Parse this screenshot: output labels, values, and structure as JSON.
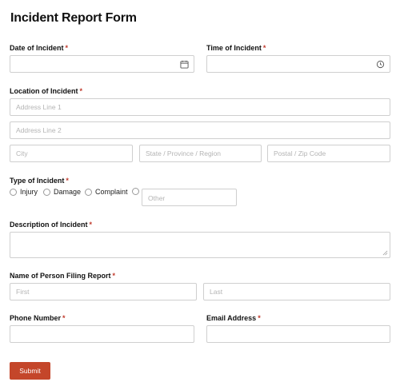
{
  "form": {
    "title": "Incident Report Form",
    "required_marker": "*",
    "date": {
      "label": "Date of Incident",
      "value": ""
    },
    "time": {
      "label": "Time of Incident",
      "value": ""
    },
    "location": {
      "label": "Location of Incident",
      "address1_placeholder": "Address Line 1",
      "address2_placeholder": "Address Line 2",
      "city_placeholder": "City",
      "state_placeholder": "State / Province / Region",
      "zip_placeholder": "Postal / Zip Code"
    },
    "type": {
      "label": "Type of Incident",
      "options": [
        "Injury",
        "Damage",
        "Complaint"
      ],
      "other_placeholder": "Other",
      "selected": ""
    },
    "description": {
      "label": "Description of Incident",
      "value": ""
    },
    "filer": {
      "label": "Name of Person Filing Report",
      "first_placeholder": "First",
      "last_placeholder": "Last"
    },
    "phone": {
      "label": "Phone Number",
      "value": ""
    },
    "email": {
      "label": "Email Address",
      "value": ""
    },
    "submit_label": "Submit",
    "colors": {
      "accent": "#c4462a",
      "required": "#c0392b",
      "border": "#cfcfcf",
      "placeholder": "#b4b4b4"
    },
    "icons": {
      "date": "calendar-icon",
      "time": "clock-icon"
    }
  }
}
